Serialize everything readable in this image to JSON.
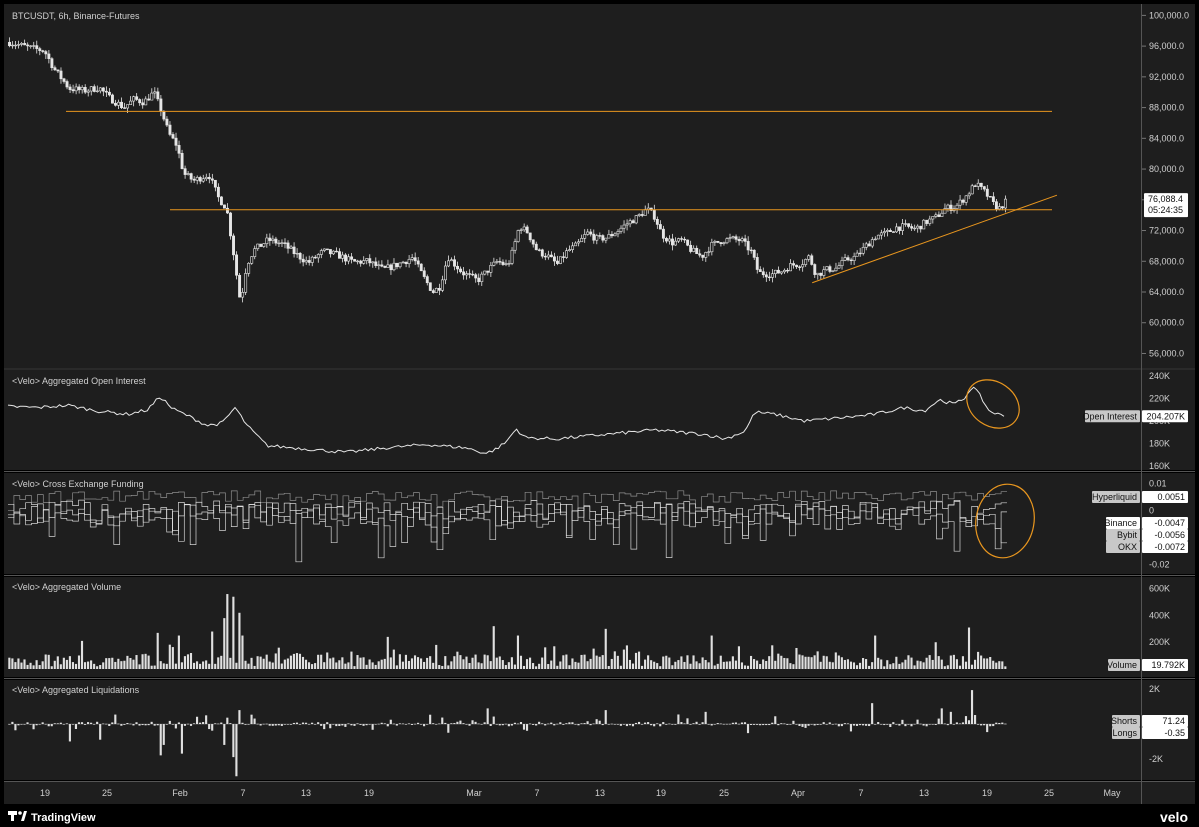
{
  "chart_data": {
    "type": "line",
    "title": "BTCUSDT, 6h, Binance-Futures",
    "timeframe": "6h",
    "grid": false,
    "x_labels": [
      "19",
      "25",
      "Feb",
      "7",
      "13",
      "19",
      "Mar",
      "7",
      "13",
      "19",
      "25",
      "Apr",
      "7",
      "13",
      "19",
      "25",
      "May"
    ],
    "price": {
      "y_ticks": [
        "100,000.0",
        "96,000.0",
        "92,000.0",
        "88,000.0",
        "84,000.0",
        "80,000.0",
        "76,000.0",
        "72,000.0",
        "68,000.0",
        "64,000.0",
        "60,000.0",
        "56,000.0"
      ],
      "ylim": [
        54500,
        100700
      ],
      "last_value": "76,088.4",
      "countdown": "05:24:35",
      "horizontal_levels": [
        87500,
        74700
      ],
      "trendline": {
        "start": [
          65200,
          0.805
        ],
        "end": [
          76600,
          1.05
        ]
      },
      "path": [
        [
          0.0,
          96500
        ],
        [
          0.02,
          95800
        ],
        [
          0.035,
          95400
        ],
        [
          0.045,
          93000
        ],
        [
          0.06,
          90500
        ],
        [
          0.075,
          90200
        ],
        [
          0.09,
          90600
        ],
        [
          0.1,
          89300
        ],
        [
          0.115,
          88000
        ],
        [
          0.125,
          89100
        ],
        [
          0.135,
          88700
        ],
        [
          0.145,
          90000
        ],
        [
          0.153,
          87400
        ],
        [
          0.16,
          84600
        ],
        [
          0.168,
          83100
        ],
        [
          0.175,
          79400
        ],
        [
          0.185,
          78500
        ],
        [
          0.2,
          79300
        ],
        [
          0.21,
          76200
        ],
        [
          0.218,
          74900
        ],
        [
          0.225,
          69000
        ],
        [
          0.232,
          62500
        ],
        [
          0.238,
          67500
        ],
        [
          0.245,
          69400
        ],
        [
          0.26,
          70800
        ],
        [
          0.275,
          70200
        ],
        [
          0.29,
          68700
        ],
        [
          0.3,
          67800
        ],
        [
          0.315,
          69300
        ],
        [
          0.33,
          68800
        ],
        [
          0.345,
          67900
        ],
        [
          0.36,
          68000
        ],
        [
          0.375,
          66900
        ],
        [
          0.39,
          67600
        ],
        [
          0.405,
          68500
        ],
        [
          0.415,
          66100
        ],
        [
          0.425,
          64000
        ],
        [
          0.432,
          64700
        ],
        [
          0.44,
          68600
        ],
        [
          0.455,
          66500
        ],
        [
          0.47,
          65500
        ],
        [
          0.48,
          66800
        ],
        [
          0.49,
          68000
        ],
        [
          0.5,
          67400
        ],
        [
          0.505,
          69200
        ],
        [
          0.512,
          72600
        ],
        [
          0.52,
          71800
        ],
        [
          0.53,
          69300
        ],
        [
          0.54,
          68700
        ],
        [
          0.55,
          67600
        ],
        [
          0.56,
          69300
        ],
        [
          0.57,
          70100
        ],
        [
          0.58,
          71700
        ],
        [
          0.59,
          70900
        ],
        [
          0.6,
          71100
        ],
        [
          0.61,
          71900
        ],
        [
          0.62,
          72900
        ],
        [
          0.63,
          73700
        ],
        [
          0.64,
          74800
        ],
        [
          0.648,
          73800
        ],
        [
          0.655,
          71500
        ],
        [
          0.665,
          70400
        ],
        [
          0.675,
          70700
        ],
        [
          0.685,
          69400
        ],
        [
          0.695,
          68600
        ],
        [
          0.705,
          70100
        ],
        [
          0.715,
          70700
        ],
        [
          0.725,
          70900
        ],
        [
          0.735,
          70700
        ],
        [
          0.745,
          69200
        ],
        [
          0.752,
          66500
        ],
        [
          0.765,
          66300
        ],
        [
          0.775,
          66700
        ],
        [
          0.785,
          67500
        ],
        [
          0.795,
          67700
        ],
        [
          0.803,
          68600
        ],
        [
          0.81,
          66200
        ],
        [
          0.82,
          66900
        ],
        [
          0.83,
          67100
        ],
        [
          0.84,
          68200
        ],
        [
          0.85,
          68600
        ],
        [
          0.86,
          70000
        ],
        [
          0.87,
          71300
        ],
        [
          0.88,
          71600
        ],
        [
          0.89,
          72400
        ],
        [
          0.9,
          72500
        ],
        [
          0.91,
          72200
        ],
        [
          0.92,
          73100
        ],
        [
          0.93,
          73700
        ],
        [
          0.94,
          74900
        ],
        [
          0.95,
          75100
        ],
        [
          0.96,
          76400
        ],
        [
          0.97,
          78100
        ],
        [
          0.98,
          76900
        ],
        [
          0.988,
          75400
        ],
        [
          0.995,
          74800
        ],
        [
          1.0,
          76088
        ]
      ]
    },
    "open_interest": {
      "title": "<Velo> Aggregated Open Interest",
      "y_ticks": [
        "240K",
        "220K",
        "200K",
        "180K",
        "160K"
      ],
      "ylim": [
        158000,
        242000
      ],
      "last_value": "204.207K",
      "tag_label": "Open Interest",
      "path": [
        [
          0.0,
          213000
        ],
        [
          0.03,
          212000
        ],
        [
          0.06,
          214000
        ],
        [
          0.09,
          209000
        ],
        [
          0.12,
          206000
        ],
        [
          0.14,
          210000
        ],
        [
          0.153,
          222000
        ],
        [
          0.165,
          211000
        ],
        [
          0.18,
          205000
        ],
        [
          0.2,
          196000
        ],
        [
          0.215,
          198000
        ],
        [
          0.228,
          212000
        ],
        [
          0.24,
          196000
        ],
        [
          0.26,
          178000
        ],
        [
          0.3,
          175000
        ],
        [
          0.34,
          172000
        ],
        [
          0.38,
          176000
        ],
        [
          0.42,
          179000
        ],
        [
          0.46,
          176000
        ],
        [
          0.48,
          171000
        ],
        [
          0.49,
          175000
        ],
        [
          0.5,
          181000
        ],
        [
          0.51,
          193000
        ],
        [
          0.52,
          185000
        ],
        [
          0.55,
          184000
        ],
        [
          0.6,
          188000
        ],
        [
          0.65,
          192000
        ],
        [
          0.7,
          188000
        ],
        [
          0.72,
          184000
        ],
        [
          0.74,
          191000
        ],
        [
          0.75,
          208000
        ],
        [
          0.77,
          206000
        ],
        [
          0.8,
          200000
        ],
        [
          0.85,
          204000
        ],
        [
          0.87,
          206000
        ],
        [
          0.9,
          212000
        ],
        [
          0.92,
          209000
        ],
        [
          0.935,
          219000
        ],
        [
          0.95,
          215000
        ],
        [
          0.96,
          220000
        ],
        [
          0.968,
          231000
        ],
        [
          0.975,
          224000
        ],
        [
          0.985,
          209000
        ],
        [
          1.0,
          204207
        ]
      ]
    },
    "funding": {
      "title": "<Velo> Cross Exchange Funding",
      "y_ticks": [
        "0.01",
        "0",
        "-0.02"
      ],
      "ylim": [
        -0.0225,
        0.0125
      ],
      "series": [
        {
          "name": "Hyperliquid",
          "last_value": "0.0051",
          "base": 0.0052,
          "amp": 0.0022
        },
        {
          "name": "Binance",
          "last_value": "-0.0047",
          "base": -0.0012,
          "amp": 0.0045
        },
        {
          "name": "Bybit",
          "last_value": "-0.0056",
          "base": -0.0006,
          "amp": 0.004
        },
        {
          "name": "OKX",
          "last_value": "-0.0072",
          "base": -0.0015,
          "amp": 0.0055
        }
      ]
    },
    "volume": {
      "title": "<Velo> Aggregated Volume",
      "y_ticks": [
        "600K",
        "400K",
        "200K"
      ],
      "ylim": [
        0,
        650000
      ],
      "last_value": "19.792K",
      "tag_label": "Volume",
      "bar_count": 330,
      "spikes": [
        [
          0.22,
          560000
        ],
        [
          0.225,
          540000
        ],
        [
          0.215,
          380000
        ],
        [
          0.23,
          420000
        ],
        [
          0.205,
          280000
        ],
        [
          0.235,
          250000
        ],
        [
          0.148,
          270000
        ],
        [
          0.17,
          250000
        ],
        [
          0.072,
          210000
        ],
        [
          0.485,
          320000
        ],
        [
          0.5,
          280000
        ],
        [
          0.51,
          250000
        ],
        [
          0.6,
          300000
        ],
        [
          0.705,
          250000
        ],
        [
          0.87,
          250000
        ],
        [
          0.93,
          200000
        ],
        [
          0.965,
          310000
        ],
        [
          0.38,
          240000
        ],
        [
          0.6,
          300000
        ],
        [
          0.43,
          180000
        ]
      ]
    },
    "liquidations": {
      "title": "<Velo> Aggregated Liquidations",
      "y_ticks": [
        "2K",
        "-2K"
      ],
      "ylim": [
        -3100,
        2300
      ],
      "shorts": "71.24",
      "longs": "-0.35",
      "bar_count": 330,
      "spikes": [
        [
          0.968,
          1950
        ],
        [
          0.865,
          1200
        ],
        [
          0.935,
          900
        ],
        [
          0.23,
          800
        ],
        [
          0.48,
          900
        ],
        [
          0.6,
          800
        ],
        [
          0.7,
          700
        ],
        [
          0.228,
          -3000
        ],
        [
          0.225,
          -1900
        ],
        [
          0.215,
          -1200
        ],
        [
          0.173,
          -1700
        ],
        [
          0.152,
          -1800
        ],
        [
          0.155,
          -1200
        ],
        [
          0.09,
          -900
        ],
        [
          0.06,
          -1000
        ],
        [
          0.945,
          700
        ],
        [
          0.5,
          -600
        ]
      ]
    }
  },
  "footer": {
    "brand": "TradingView",
    "watermark": "velo"
  },
  "colors": {
    "background": "#000000",
    "pane_background": "#1e1e1e",
    "line": "#e6e6e6",
    "accent_orange": "#e8961f",
    "tag_fill": "#c8c8c8",
    "tag_fill_light": "#ffffff"
  }
}
